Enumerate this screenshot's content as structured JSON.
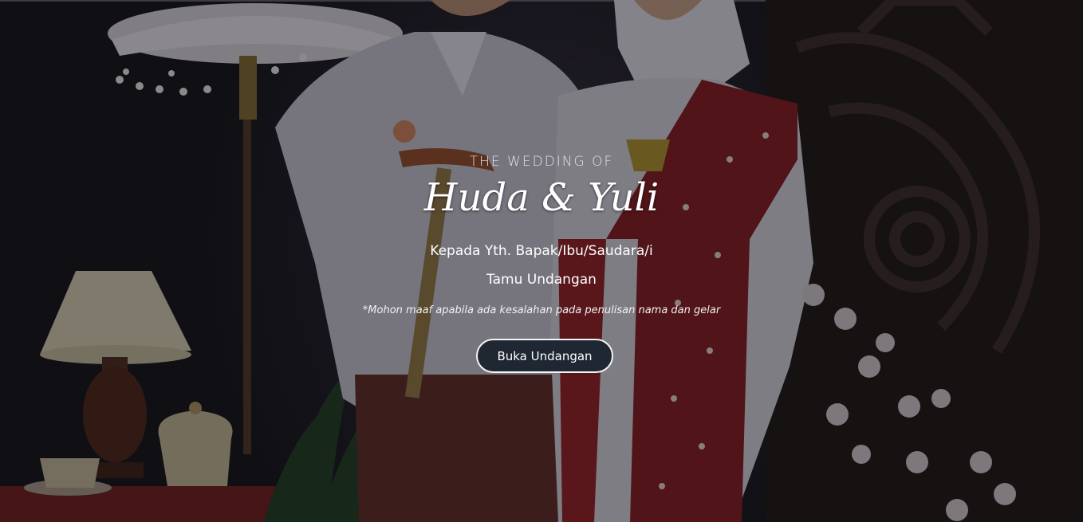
{
  "hero": {
    "eyebrow": "THE WEDDING OF",
    "couple_names": "Huda & Yuli",
    "greeting": "Kepada Yth. Bapak/Ibu/Saudara/i",
    "guest_name": "Tamu Undangan",
    "disclaimer": "*Mohon maaf apabila ada kesalahan pada penulisan nama dan gelar",
    "open_button_label": "Buka Undangan"
  },
  "colors": {
    "button_bg": "#1f2733",
    "button_border": "#f3f3f3",
    "text": "#ffffff",
    "batik_red": "#b3262c"
  }
}
